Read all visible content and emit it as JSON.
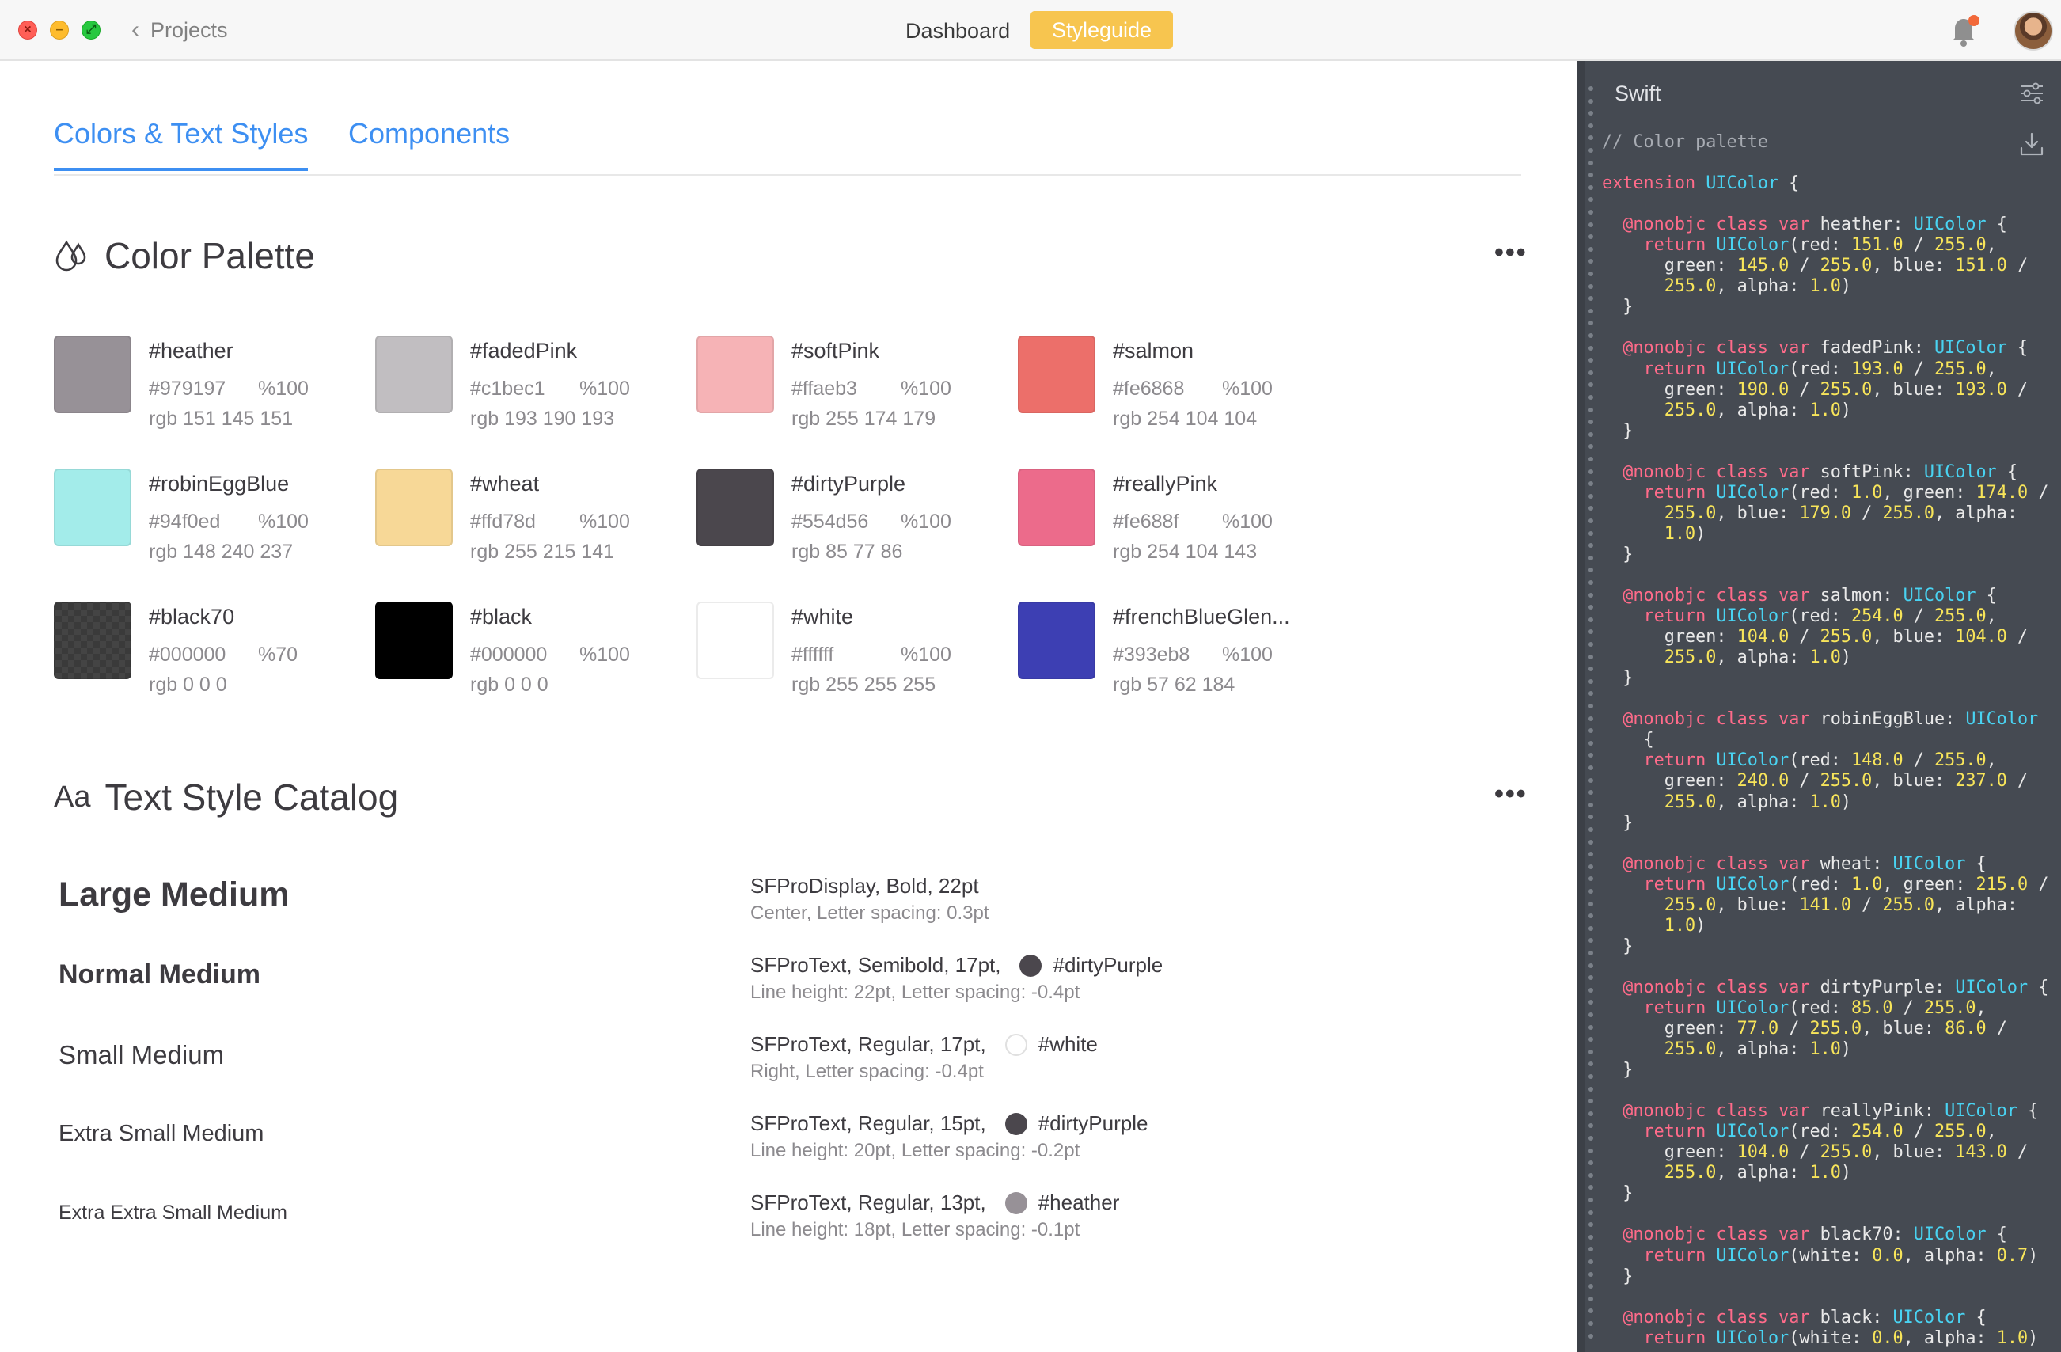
{
  "titlebar": {
    "back_label": "Projects",
    "nav": {
      "dashboard": "Dashboard",
      "styleguide": "Styleguide"
    },
    "icons": {
      "back": "chevron-left-icon",
      "notifications": "bell-icon",
      "profile": "avatar"
    }
  },
  "tabs": [
    {
      "label": "Colors & Text Styles",
      "active": true
    },
    {
      "label": "Components",
      "active": false
    }
  ],
  "color_palette": {
    "title": "Color Palette",
    "icon": "drops-icon",
    "more_icon": "more-dots-icon",
    "colors": [
      {
        "name": "#heather",
        "hex": "#979197",
        "opacity": "%100",
        "rgb": "rgb 151 145 151",
        "swatch": "#979197"
      },
      {
        "name": "#fadedPink",
        "hex": "#c1bec1",
        "opacity": "%100",
        "rgb": "rgb 193 190 193",
        "swatch": "#c1bec1"
      },
      {
        "name": "#softPink",
        "hex": "#ffaeb3",
        "opacity": "%100",
        "rgb": "rgb 255 174 179",
        "swatch": "#f6b3b6"
      },
      {
        "name": "#salmon",
        "hex": "#fe6868",
        "opacity": "%100",
        "rgb": "rgb 254 104 104",
        "swatch": "#ec6f6a"
      },
      {
        "name": "#robinEggBlue",
        "hex": "#94f0ed",
        "opacity": "%100",
        "rgb": "rgb 148 240 237",
        "swatch": "#a3ecea"
      },
      {
        "name": "#wheat",
        "hex": "#ffd78d",
        "opacity": "%100",
        "rgb": "rgb 255 215 141",
        "swatch": "#f7d897"
      },
      {
        "name": "#dirtyPurple",
        "hex": "#554d56",
        "opacity": "%100",
        "rgb": "rgb 85 77 86",
        "swatch": "#4b474d"
      },
      {
        "name": "#reallyPink",
        "hex": "#fe688f",
        "opacity": "%100",
        "rgb": "rgb 254 104 143",
        "swatch": "#ec6b8b"
      },
      {
        "name": "#black70",
        "hex": "#000000",
        "opacity": "%70",
        "rgb": "rgb 0 0 0",
        "swatch": "#3f3f3f"
      },
      {
        "name": "#black",
        "hex": "#000000",
        "opacity": "%100",
        "rgb": "rgb 0 0 0",
        "swatch": "#000000"
      },
      {
        "name": "#white",
        "hex": "#ffffff",
        "opacity": "%100",
        "rgb": "rgb 255 255 255",
        "swatch": "#ffffff"
      },
      {
        "name": "#frenchBlueGlen...",
        "hex": "#393eb8",
        "opacity": "%100",
        "rgb": "rgb 57 62 184",
        "swatch": "#3d3fb3"
      }
    ]
  },
  "text_styles": {
    "title": "Text Style Catalog",
    "icon_text": "Aa",
    "more_icon": "more-dots-icon",
    "items": [
      {
        "sample": "Large Medium",
        "spec": "SFProDisplay, Bold, 22pt",
        "detail": "Center, Letter spacing: 0.3pt",
        "color_name": "",
        "color": ""
      },
      {
        "sample": "Normal Medium",
        "spec": "SFProText, Semibold, 17pt,",
        "detail": "Line height: 22pt, Letter spacing: -0.4pt",
        "color_name": "#dirtyPurple",
        "color": "#4b474d"
      },
      {
        "sample": "Small Medium",
        "spec": "SFProText, Regular, 17pt,",
        "detail": "Right, Letter spacing: -0.4pt",
        "color_name": "#white",
        "color": "#ffffff"
      },
      {
        "sample": "Extra Small Medium",
        "spec": "SFProText, Regular, 15pt,",
        "detail": "Line height: 20pt, Letter spacing: -0.2pt",
        "color_name": "#dirtyPurple",
        "color": "#4b474d"
      },
      {
        "sample": "Extra Extra Small Medium",
        "spec": "SFProText, Regular, 13pt,",
        "detail": "Line height: 18pt, Letter spacing: -0.1pt",
        "color_name": "#heather",
        "color": "#979197"
      }
    ]
  },
  "code_panel": {
    "language": "Swift",
    "icons": {
      "settings": "sliders-icon",
      "download": "download-icon"
    },
    "lines": [
      [
        [
          "cm",
          "// Color palette"
        ]
      ],
      [],
      [
        [
          "kw",
          "extension "
        ],
        [
          "ty",
          "UIColor"
        ],
        [
          "pl",
          " {"
        ]
      ],
      [],
      [
        [
          "kw",
          "  @nonobjc class var "
        ],
        [
          "pl",
          "heather: "
        ],
        [
          "ty",
          "UIColor"
        ],
        [
          "pl",
          " {"
        ]
      ],
      [
        [
          "kw",
          "    return "
        ],
        [
          "ty",
          "UIColor"
        ],
        [
          "pl",
          "(red: "
        ],
        [
          "nm",
          "151.0"
        ],
        [
          "pl",
          " / "
        ],
        [
          "nm",
          "255.0"
        ],
        [
          "pl",
          ","
        ]
      ],
      [
        [
          "pl",
          "      green: "
        ],
        [
          "nm",
          "145.0"
        ],
        [
          "pl",
          " / "
        ],
        [
          "nm",
          "255.0"
        ],
        [
          "pl",
          ", blue: "
        ],
        [
          "nm",
          "151.0"
        ],
        [
          "pl",
          " /"
        ]
      ],
      [
        [
          "pl",
          "      "
        ],
        [
          "nm",
          "255.0"
        ],
        [
          "pl",
          ", alpha: "
        ],
        [
          "nm",
          "1.0"
        ],
        [
          "pl",
          ")"
        ]
      ],
      [
        [
          "pl",
          "  }"
        ]
      ],
      [],
      [
        [
          "kw",
          "  @nonobjc class var "
        ],
        [
          "pl",
          "fadedPink: "
        ],
        [
          "ty",
          "UIColor"
        ],
        [
          "pl",
          " {"
        ]
      ],
      [
        [
          "kw",
          "    return "
        ],
        [
          "ty",
          "UIColor"
        ],
        [
          "pl",
          "(red: "
        ],
        [
          "nm",
          "193.0"
        ],
        [
          "pl",
          " / "
        ],
        [
          "nm",
          "255.0"
        ],
        [
          "pl",
          ","
        ]
      ],
      [
        [
          "pl",
          "      green: "
        ],
        [
          "nm",
          "190.0"
        ],
        [
          "pl",
          " / "
        ],
        [
          "nm",
          "255.0"
        ],
        [
          "pl",
          ", blue: "
        ],
        [
          "nm",
          "193.0"
        ],
        [
          "pl",
          " /"
        ]
      ],
      [
        [
          "pl",
          "      "
        ],
        [
          "nm",
          "255.0"
        ],
        [
          "pl",
          ", alpha: "
        ],
        [
          "nm",
          "1.0"
        ],
        [
          "pl",
          ")"
        ]
      ],
      [
        [
          "pl",
          "  }"
        ]
      ],
      [],
      [
        [
          "kw",
          "  @nonobjc class var "
        ],
        [
          "pl",
          "softPink: "
        ],
        [
          "ty",
          "UIColor"
        ],
        [
          "pl",
          " {"
        ]
      ],
      [
        [
          "kw",
          "    return "
        ],
        [
          "ty",
          "UIColor"
        ],
        [
          "pl",
          "(red: "
        ],
        [
          "nm",
          "1.0"
        ],
        [
          "pl",
          ", green: "
        ],
        [
          "nm",
          "174.0"
        ],
        [
          "pl",
          " /"
        ]
      ],
      [
        [
          "pl",
          "      "
        ],
        [
          "nm",
          "255.0"
        ],
        [
          "pl",
          ", blue: "
        ],
        [
          "nm",
          "179.0"
        ],
        [
          "pl",
          " / "
        ],
        [
          "nm",
          "255.0"
        ],
        [
          "pl",
          ", alpha:"
        ]
      ],
      [
        [
          "pl",
          "      "
        ],
        [
          "nm",
          "1.0"
        ],
        [
          "pl",
          ")"
        ]
      ],
      [
        [
          "pl",
          "  }"
        ]
      ],
      [],
      [
        [
          "kw",
          "  @nonobjc class var "
        ],
        [
          "pl",
          "salmon: "
        ],
        [
          "ty",
          "UIColor"
        ],
        [
          "pl",
          " {"
        ]
      ],
      [
        [
          "kw",
          "    return "
        ],
        [
          "ty",
          "UIColor"
        ],
        [
          "pl",
          "(red: "
        ],
        [
          "nm",
          "254.0"
        ],
        [
          "pl",
          " / "
        ],
        [
          "nm",
          "255.0"
        ],
        [
          "pl",
          ","
        ]
      ],
      [
        [
          "pl",
          "      green: "
        ],
        [
          "nm",
          "104.0"
        ],
        [
          "pl",
          " / "
        ],
        [
          "nm",
          "255.0"
        ],
        [
          "pl",
          ", blue: "
        ],
        [
          "nm",
          "104.0"
        ],
        [
          "pl",
          " /"
        ]
      ],
      [
        [
          "pl",
          "      "
        ],
        [
          "nm",
          "255.0"
        ],
        [
          "pl",
          ", alpha: "
        ],
        [
          "nm",
          "1.0"
        ],
        [
          "pl",
          ")"
        ]
      ],
      [
        [
          "pl",
          "  }"
        ]
      ],
      [],
      [
        [
          "kw",
          "  @nonobjc class var "
        ],
        [
          "pl",
          "robinEggBlue: "
        ],
        [
          "ty",
          "UIColor"
        ]
      ],
      [
        [
          "pl",
          "    {"
        ]
      ],
      [
        [
          "kw",
          "    return "
        ],
        [
          "ty",
          "UIColor"
        ],
        [
          "pl",
          "(red: "
        ],
        [
          "nm",
          "148.0"
        ],
        [
          "pl",
          " / "
        ],
        [
          "nm",
          "255.0"
        ],
        [
          "pl",
          ","
        ]
      ],
      [
        [
          "pl",
          "      green: "
        ],
        [
          "nm",
          "240.0"
        ],
        [
          "pl",
          " / "
        ],
        [
          "nm",
          "255.0"
        ],
        [
          "pl",
          ", blue: "
        ],
        [
          "nm",
          "237.0"
        ],
        [
          "pl",
          " /"
        ]
      ],
      [
        [
          "pl",
          "      "
        ],
        [
          "nm",
          "255.0"
        ],
        [
          "pl",
          ", alpha: "
        ],
        [
          "nm",
          "1.0"
        ],
        [
          "pl",
          ")"
        ]
      ],
      [
        [
          "pl",
          "  }"
        ]
      ],
      [],
      [
        [
          "kw",
          "  @nonobjc class var "
        ],
        [
          "pl",
          "wheat: "
        ],
        [
          "ty",
          "UIColor"
        ],
        [
          "pl",
          " {"
        ]
      ],
      [
        [
          "kw",
          "    return "
        ],
        [
          "ty",
          "UIColor"
        ],
        [
          "pl",
          "(red: "
        ],
        [
          "nm",
          "1.0"
        ],
        [
          "pl",
          ", green: "
        ],
        [
          "nm",
          "215.0"
        ],
        [
          "pl",
          " /"
        ]
      ],
      [
        [
          "pl",
          "      "
        ],
        [
          "nm",
          "255.0"
        ],
        [
          "pl",
          ", blue: "
        ],
        [
          "nm",
          "141.0"
        ],
        [
          "pl",
          " / "
        ],
        [
          "nm",
          "255.0"
        ],
        [
          "pl",
          ", alpha:"
        ]
      ],
      [
        [
          "pl",
          "      "
        ],
        [
          "nm",
          "1.0"
        ],
        [
          "pl",
          ")"
        ]
      ],
      [
        [
          "pl",
          "  }"
        ]
      ],
      [],
      [
        [
          "kw",
          "  @nonobjc class var "
        ],
        [
          "pl",
          "dirtyPurple: "
        ],
        [
          "ty",
          "UIColor"
        ],
        [
          "pl",
          " {"
        ]
      ],
      [
        [
          "kw",
          "    return "
        ],
        [
          "ty",
          "UIColor"
        ],
        [
          "pl",
          "(red: "
        ],
        [
          "nm",
          "85.0"
        ],
        [
          "pl",
          " / "
        ],
        [
          "nm",
          "255.0"
        ],
        [
          "pl",
          ","
        ]
      ],
      [
        [
          "pl",
          "      green: "
        ],
        [
          "nm",
          "77.0"
        ],
        [
          "pl",
          " / "
        ],
        [
          "nm",
          "255.0"
        ],
        [
          "pl",
          ", blue: "
        ],
        [
          "nm",
          "86.0"
        ],
        [
          "pl",
          " /"
        ]
      ],
      [
        [
          "pl",
          "      "
        ],
        [
          "nm",
          "255.0"
        ],
        [
          "pl",
          ", alpha: "
        ],
        [
          "nm",
          "1.0"
        ],
        [
          "pl",
          ")"
        ]
      ],
      [
        [
          "pl",
          "  }"
        ]
      ],
      [],
      [
        [
          "kw",
          "  @nonobjc class var "
        ],
        [
          "pl",
          "reallyPink: "
        ],
        [
          "ty",
          "UIColor"
        ],
        [
          "pl",
          " {"
        ]
      ],
      [
        [
          "kw",
          "    return "
        ],
        [
          "ty",
          "UIColor"
        ],
        [
          "pl",
          "(red: "
        ],
        [
          "nm",
          "254.0"
        ],
        [
          "pl",
          " / "
        ],
        [
          "nm",
          "255.0"
        ],
        [
          "pl",
          ","
        ]
      ],
      [
        [
          "pl",
          "      green: "
        ],
        [
          "nm",
          "104.0"
        ],
        [
          "pl",
          " / "
        ],
        [
          "nm",
          "255.0"
        ],
        [
          "pl",
          ", blue: "
        ],
        [
          "nm",
          "143.0"
        ],
        [
          "pl",
          " /"
        ]
      ],
      [
        [
          "pl",
          "      "
        ],
        [
          "nm",
          "255.0"
        ],
        [
          "pl",
          ", alpha: "
        ],
        [
          "nm",
          "1.0"
        ],
        [
          "pl",
          ")"
        ]
      ],
      [
        [
          "pl",
          "  }"
        ]
      ],
      [],
      [
        [
          "kw",
          "  @nonobjc class var "
        ],
        [
          "pl",
          "black70: "
        ],
        [
          "ty",
          "UIColor"
        ],
        [
          "pl",
          " {"
        ]
      ],
      [
        [
          "kw",
          "    return "
        ],
        [
          "ty",
          "UIColor"
        ],
        [
          "pl",
          "(white: "
        ],
        [
          "nm",
          "0.0"
        ],
        [
          "pl",
          ", alpha: "
        ],
        [
          "nm",
          "0.7"
        ],
        [
          "pl",
          ")"
        ]
      ],
      [
        [
          "pl",
          "  }"
        ]
      ],
      [],
      [
        [
          "kw",
          "  @nonobjc class var "
        ],
        [
          "pl",
          "black: "
        ],
        [
          "ty",
          "UIColor"
        ],
        [
          "pl",
          " {"
        ]
      ],
      [
        [
          "kw",
          "    return "
        ],
        [
          "ty",
          "UIColor"
        ],
        [
          "pl",
          "(white: "
        ],
        [
          "nm",
          "0.0"
        ],
        [
          "pl",
          ", alpha: "
        ],
        [
          "nm",
          "1.0"
        ],
        [
          "pl",
          ")"
        ]
      ]
    ]
  }
}
